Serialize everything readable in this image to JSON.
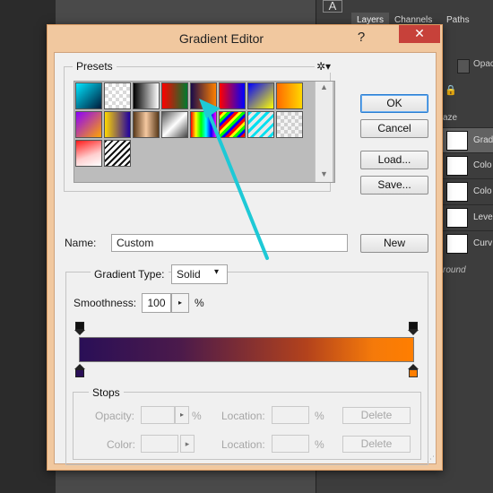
{
  "background_panel": {
    "tool_icon": "A",
    "tabs": [
      "Layers",
      "Channels",
      "Paths"
    ],
    "opacity_label": "Opac",
    "lock_icon": "lock-icon",
    "faze_label": "aze",
    "layers": [
      {
        "label": "Grad",
        "selected": true
      },
      {
        "label": "Colo"
      },
      {
        "label": "Colo"
      },
      {
        "label": "Leve"
      },
      {
        "label": "Curv"
      }
    ],
    "background_label": "round"
  },
  "dialog": {
    "title": "Gradient Editor",
    "help_glyph": "?",
    "close_glyph": "✕",
    "title_bar_color": "#f1c89f",
    "close_color": "#c7413a"
  },
  "presets": {
    "title": "Presets",
    "gear_icon": "gear-icon",
    "gear_glyph": "✲▾",
    "scroll_up_glyph": "▲",
    "scroll_down_glyph": "▼",
    "swatches": [
      "linear-gradient(135deg,#00e5ff,#001a3a)",
      "repeating-conic-gradient(#d9d9d9 0 25%,#fff 0 50%) 0 0/8px 8px",
      "linear-gradient(90deg,#000,#fff)",
      "linear-gradient(90deg,#ff0000,#007a2e)",
      "linear-gradient(90deg,#1a0b4a,#ff8000)",
      "linear-gradient(90deg,#ff0000,#0000ff)",
      "linear-gradient(135deg,#0000ff,#ffff00)",
      "linear-gradient(90deg,#ff6a00,#ffd800)",
      "linear-gradient(135deg,#8b00ff,#ffa500)",
      "linear-gradient(90deg,#ffd700,#2000a0)",
      "linear-gradient(90deg,#5a3a1a,#f5c8a0,#5a3a1a)",
      "linear-gradient(135deg,#555,#fff,#444)",
      "linear-gradient(90deg,#ff0000,#ffff00,#00ff00,#00ffff,#0000ff,#ff00ff)",
      "repeating-linear-gradient(135deg,#ff0000 0 3px,#ffff00 3px 6px,#00ff00 6px 9px,#0000ff 9px 12px)",
      "repeating-linear-gradient(135deg,#00e0f0 0 3px,#e8e8e8 3px 7px)",
      "repeating-conic-gradient(#cfcfcf 0 25%,#f4f4f4 0 50%) 0 0/8px 8px",
      "linear-gradient(160deg,#ff1a1a,#ffd0d0 60%,#fff)",
      "repeating-linear-gradient(135deg,#111 0 2px,#fff 2px 5px)"
    ]
  },
  "buttons": {
    "ok": "OK",
    "cancel": "Cancel",
    "load": "Load...",
    "save": "Save...",
    "new": "New"
  },
  "name": {
    "label": "Name:",
    "value": "Custom"
  },
  "gradient": {
    "type_label": "Gradient Type:",
    "type_value": "Solid",
    "caret": "▾",
    "smoothness_label": "Smoothness:",
    "smoothness_value": "100",
    "smoothness_arrow": "▸",
    "smoothness_unit": "%",
    "start_color": "#2a0f57",
    "end_color": "#ff7e00"
  },
  "stops": {
    "title": "Stops",
    "opacity_label": "Opacity:",
    "opacity_arrow": "▸",
    "opacity_unit": "%",
    "location_label": "Location:",
    "location_unit": "%",
    "color_label": "Color:",
    "color_arrow": "▸",
    "delete_label": "Delete"
  },
  "annotation": {
    "color": "#1ec9d6"
  }
}
